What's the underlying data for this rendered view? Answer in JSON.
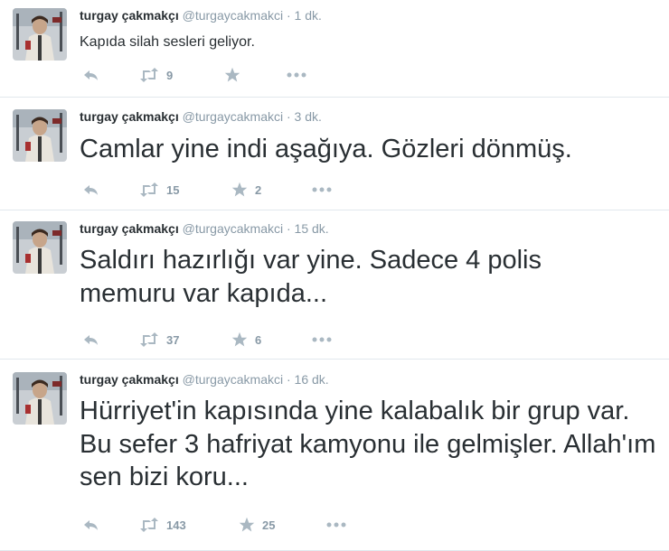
{
  "tweets": [
    {
      "name": "turgay çakmakçı",
      "handle": "@turgaycakmakci",
      "sep": "·",
      "time": "1 dk.",
      "text": "Kapıda silah sesleri geliyor.",
      "retweets": "9",
      "favorites": ""
    },
    {
      "name": "turgay çakmakçı",
      "handle": "@turgaycakmakci",
      "sep": "·",
      "time": "3 dk.",
      "text": "Camlar yine indi aşağıya. Gözleri dönmüş.",
      "retweets": "15",
      "favorites": "2"
    },
    {
      "name": "turgay çakmakçı",
      "handle": "@turgaycakmakci",
      "sep": "·",
      "time": "15 dk.",
      "text": "Saldırı hazırlığı var yine. Sadece 4 polis memuru var kapıda...",
      "retweets": "37",
      "favorites": "6"
    },
    {
      "name": "turgay çakmakçı",
      "handle": "@turgaycakmakci",
      "sep": "·",
      "time": "16 dk.",
      "text": "Hürriyet'in kapısında yine kalabalık bir grup var. Bu sefer 3 hafriyat kamyonu ile gelmişler. Allah'ım sen bizi koru...",
      "retweets": "143",
      "favorites": "25"
    }
  ],
  "icons": {
    "reply": "reply-icon",
    "retweet": "retweet-icon",
    "favorite": "star-icon",
    "more": "more-icon"
  },
  "colors": {
    "text": "#292f33",
    "meta": "#8899a6",
    "icon": "#aab8c2",
    "divider": "#e1e8ed"
  }
}
